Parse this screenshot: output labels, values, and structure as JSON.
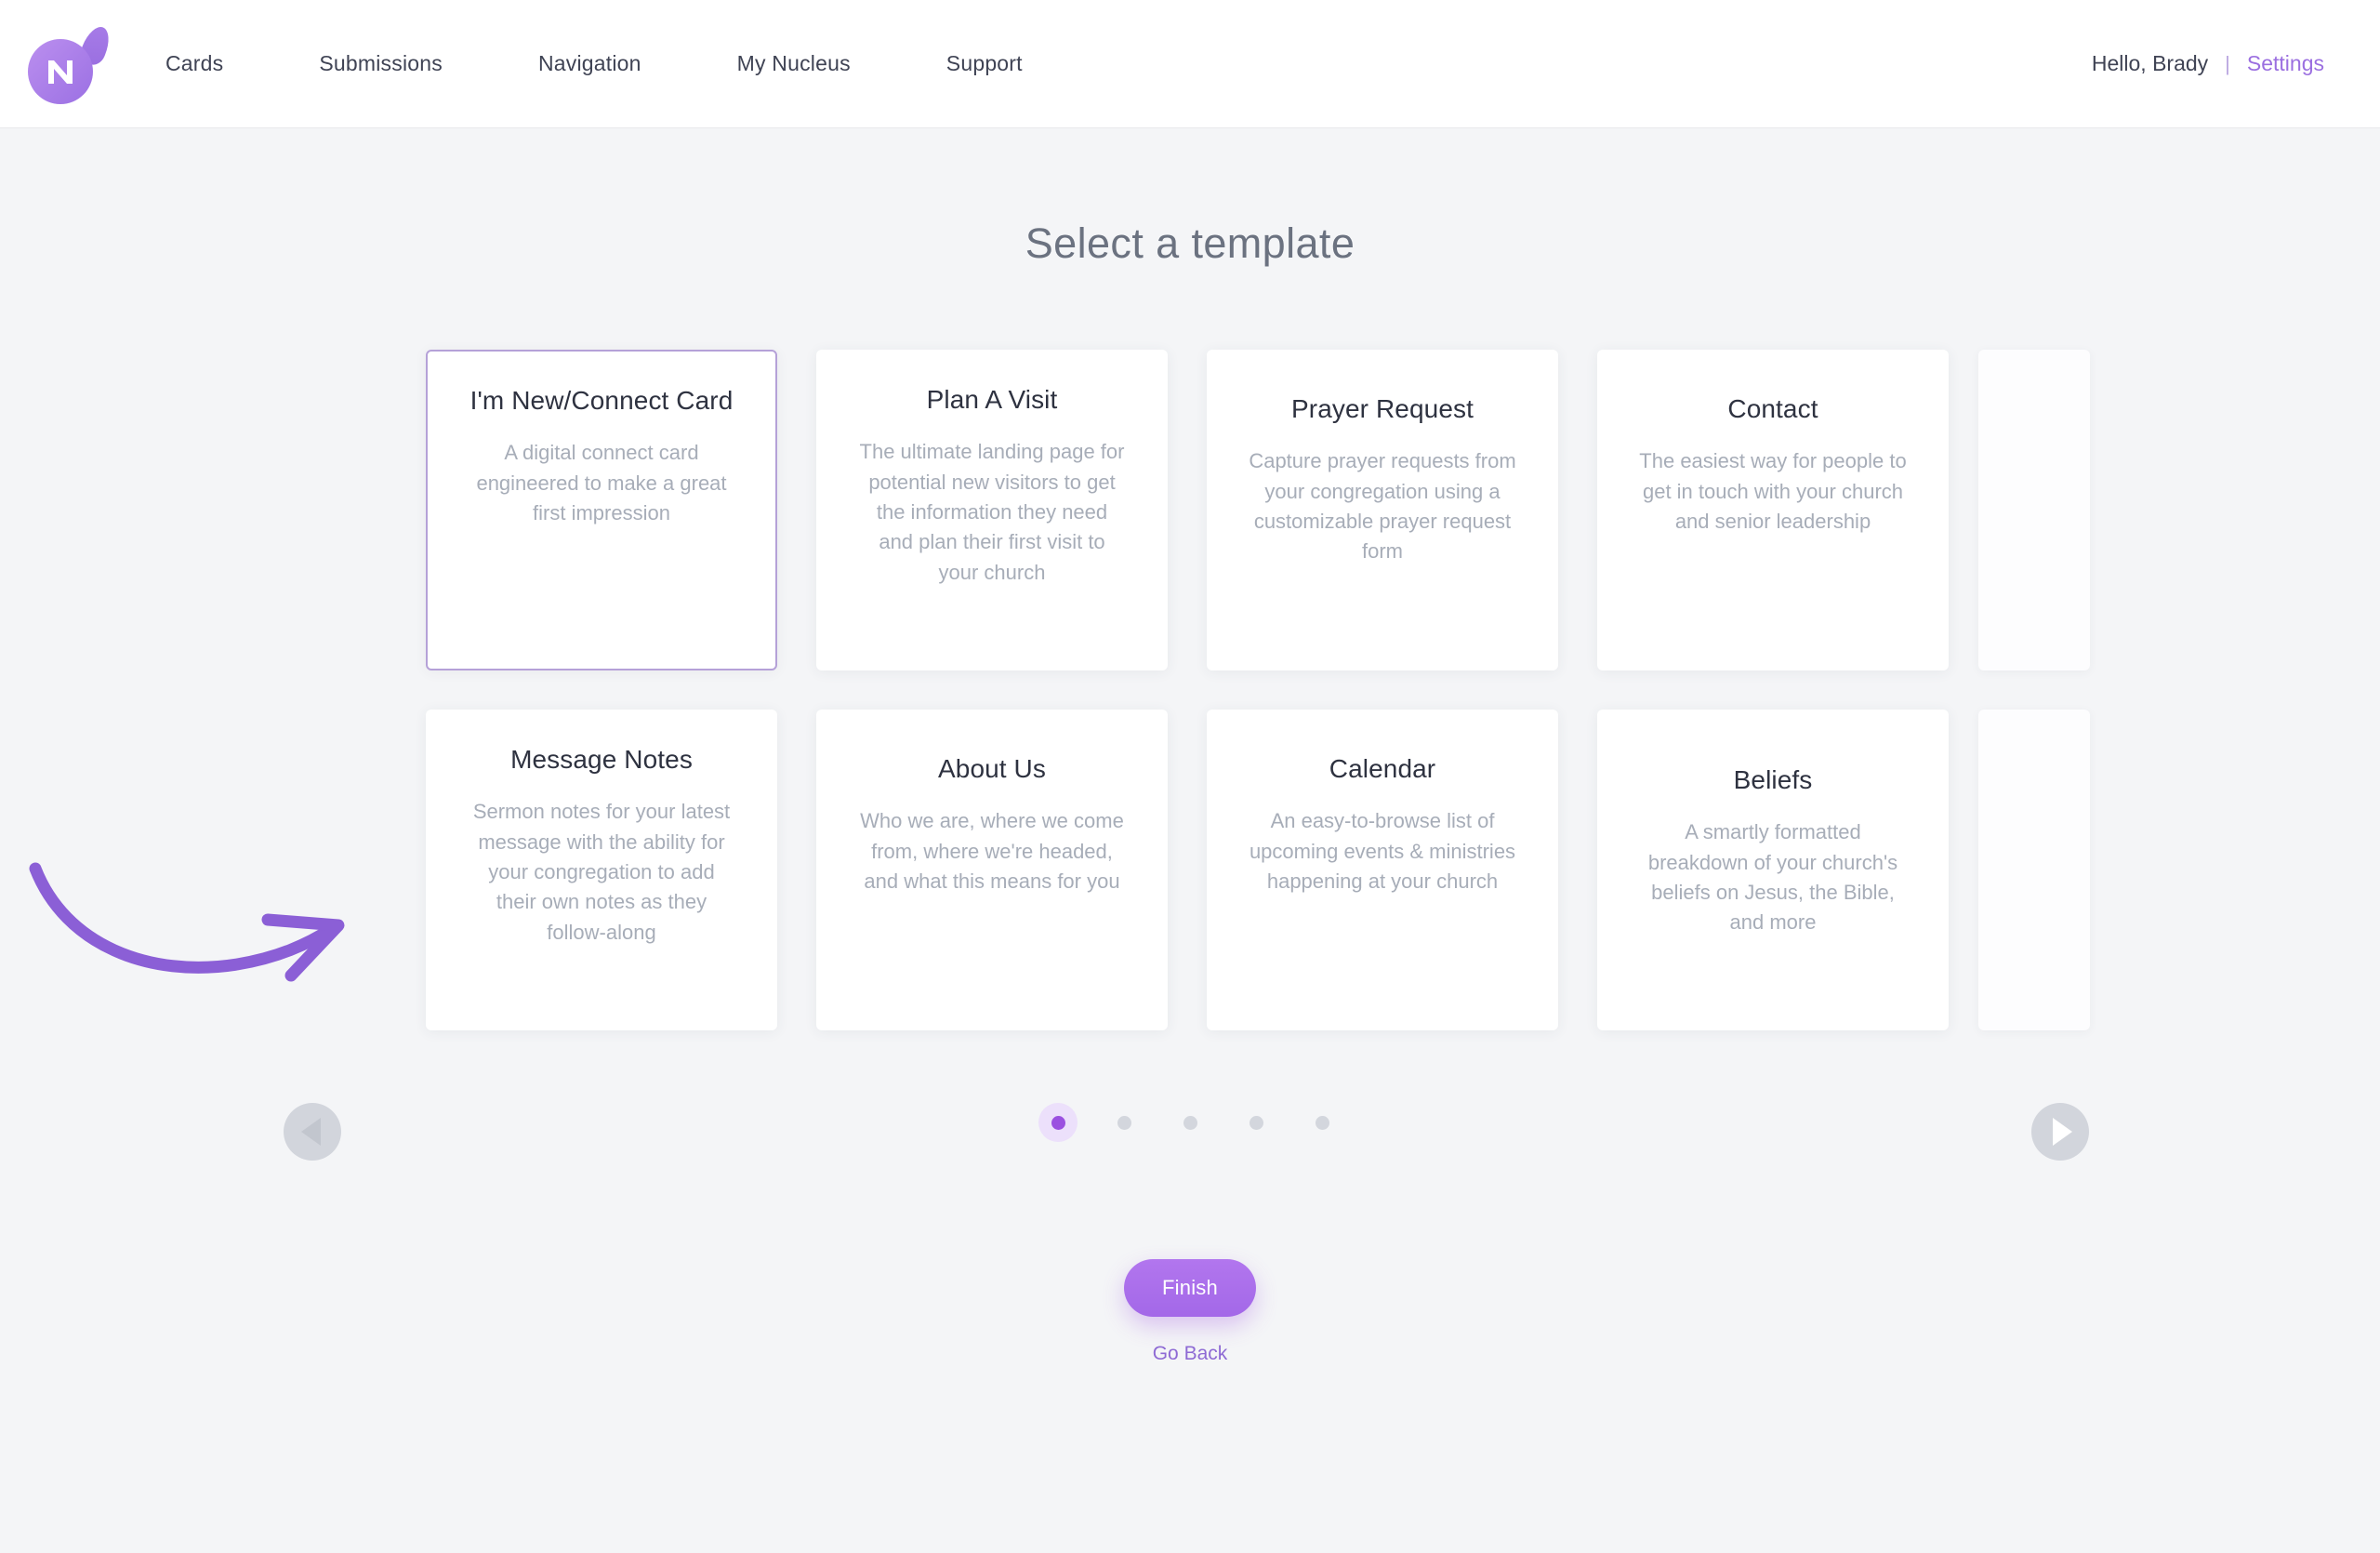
{
  "header": {
    "logo_icon": "nucleus-logo-icon",
    "nav_items": [
      {
        "label": "Cards"
      },
      {
        "label": "Submissions"
      },
      {
        "label": "Navigation"
      },
      {
        "label": "My Nucleus"
      },
      {
        "label": "Support"
      }
    ],
    "greeting": "Hello, Brady",
    "separator": "|",
    "settings_label": "Settings"
  },
  "main": {
    "page_title": "Select a template",
    "annotation": {
      "icon": "curved-arrow-annotation",
      "color": "#8b5fd6"
    },
    "carousel": {
      "prev_icon": "chevron-left-icon",
      "next_icon": "chevron-right-icon",
      "prev_enabled": false,
      "next_enabled": true,
      "page_count": 5,
      "active_page": 1,
      "accent_color": "#9b51e0",
      "selected_border_color": "#b5a1d8"
    },
    "templates": [
      {
        "title": "I'm New/Connect Card",
        "description": "A digital connect card engineered to make a great first impression",
        "selected": true
      },
      {
        "title": "Plan A Visit",
        "description": "The ultimate landing page for potential new visitors to get the information they need and plan their first visit to your church",
        "selected": false
      },
      {
        "title": "Prayer Request",
        "description": "Capture prayer requests from your congregation using a customizable prayer request form",
        "selected": false
      },
      {
        "title": "Contact",
        "description": "The easiest way for people to get in touch with your church and senior leadership",
        "selected": false
      },
      {
        "title": "Message Notes",
        "description": "Sermon notes for your latest message with the ability for your congregation to add their own notes as they follow-along",
        "selected": false
      },
      {
        "title": "About Us",
        "description": "Who we are, where we come from, where we're headed, and what this means for you",
        "selected": false
      },
      {
        "title": "Calendar",
        "description": "An easy-to-browse list of upcoming events & ministries happening at your church",
        "selected": false
      },
      {
        "title": "Beliefs",
        "description": "A smartly formatted breakdown of your church's beliefs on Jesus, the Bible, and more",
        "selected": false
      }
    ]
  },
  "footer": {
    "finish_label": "Finish",
    "go_back_label": "Go Back"
  }
}
